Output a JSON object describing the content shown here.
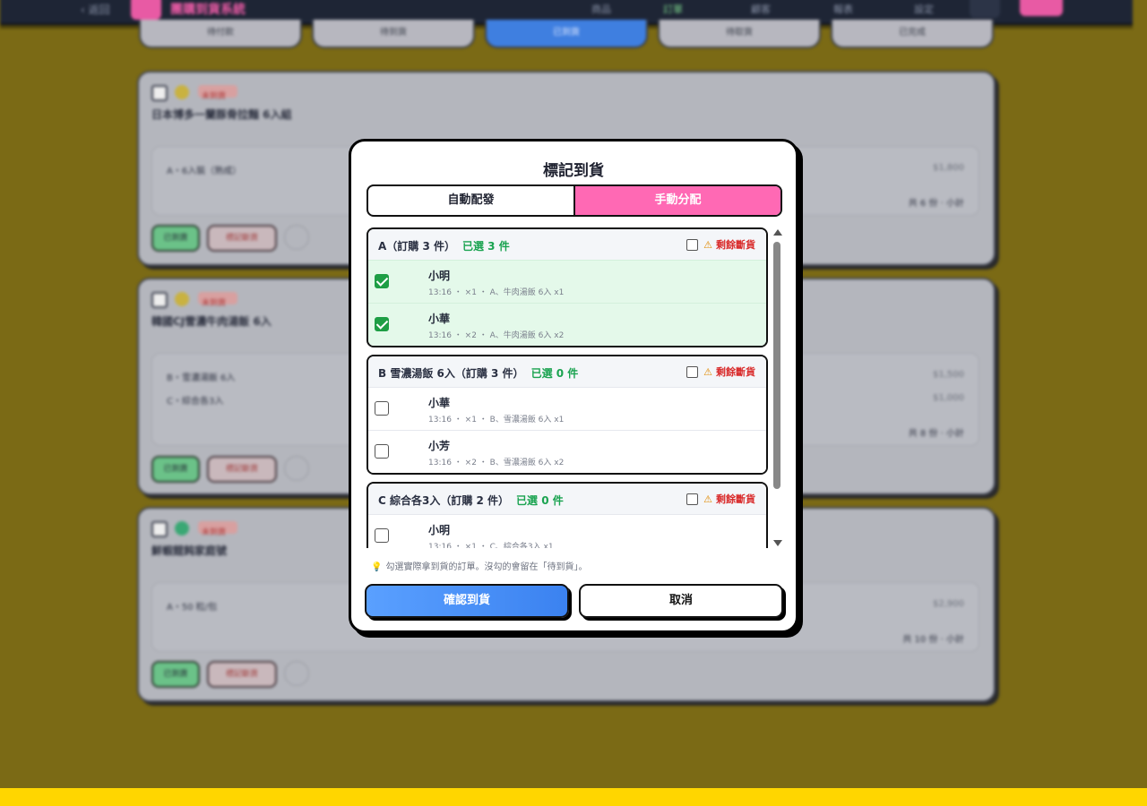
{
  "background": {
    "topbar": {
      "back": "‹ 返回",
      "app_title": "團購到貨系統",
      "nav": [
        "商品",
        "訂單",
        "顧客",
        "報表",
        "設定"
      ]
    },
    "tabs": [
      "待付款",
      "待到貨",
      "已到貨",
      "待取貨",
      "已完成"
    ],
    "cards": [
      {
        "tag": "未到貨",
        "title": "日本博多一蘭豚骨拉麵 6入組",
        "lines": [
          {
            "label": "A・6入裝（熟成）",
            "price": "$1,800"
          }
        ],
        "summary": "共 6 份 · 小計",
        "buttons": [
          "已到貨",
          "標記斷貨"
        ]
      },
      {
        "tag": "未到貨",
        "title": "韓國CJ雪濃牛肉湯飯 6入",
        "lines": [
          {
            "label": "B・雪濃湯飯 6入",
            "price": "$1,500"
          },
          {
            "label": "C・綜合各3入",
            "price": "$1,000"
          }
        ],
        "summary": "共 8 份 · 小計",
        "buttons": [
          "已到貨",
          "標記斷貨"
        ]
      },
      {
        "tag": "未到貨",
        "title": "鮮蝦餛飩家庭號",
        "lines": [
          {
            "label": "A・50 粒/包",
            "price": "$2,900"
          }
        ],
        "summary": "共 10 份 · 小計",
        "buttons": [
          "已到貨",
          "標記斷貨"
        ]
      }
    ]
  },
  "modal": {
    "title": "標記到貨",
    "modes": [
      "自動配發",
      "手動分配"
    ],
    "active_mode": "手動分配",
    "out_of_stock_label": "剩餘斷貨",
    "groups": [
      {
        "name": "A（訂購 3 件）",
        "selected": "已選 3 件",
        "orders": [
          {
            "name": "小明",
            "meta": "13:16 ・ ×1 ・ A、牛肉湯飯 6入 x1",
            "checked": true
          },
          {
            "name": "小華",
            "meta": "13:16 ・ ×2 ・ A、牛肉湯飯 6入 x2",
            "checked": true
          }
        ]
      },
      {
        "name": "B 雪濃湯飯 6入（訂購 3 件）",
        "selected": "已選 0 件",
        "orders": [
          {
            "name": "小華",
            "meta": "13:16 ・ ×1 ・ B、雪濃湯飯 6入 x1",
            "checked": false
          },
          {
            "name": "小芳",
            "meta": "13:16 ・ ×2 ・ B、雪濃湯飯 6入 x2",
            "checked": false
          }
        ]
      },
      {
        "name": "C 綜合各3入（訂購 2 件）",
        "selected": "已選 0 件",
        "orders": [
          {
            "name": "小明",
            "meta": "13:16 ・ ×1 ・ C、綜合各3入 x1",
            "checked": false
          }
        ]
      }
    ],
    "hint_icon": "lightbulb-icon",
    "hint": "勾選實際拿到貨的訂單。沒勾的會留在「待到貨」。",
    "confirm_label": "確認到貨",
    "cancel_label": "取消"
  },
  "colors": {
    "accent_pink": "#ff69b4",
    "success_green": "#1aa350",
    "danger_red": "#d92b2b",
    "primary_blue": "#3b82f0",
    "highlight": "#ffd600"
  }
}
